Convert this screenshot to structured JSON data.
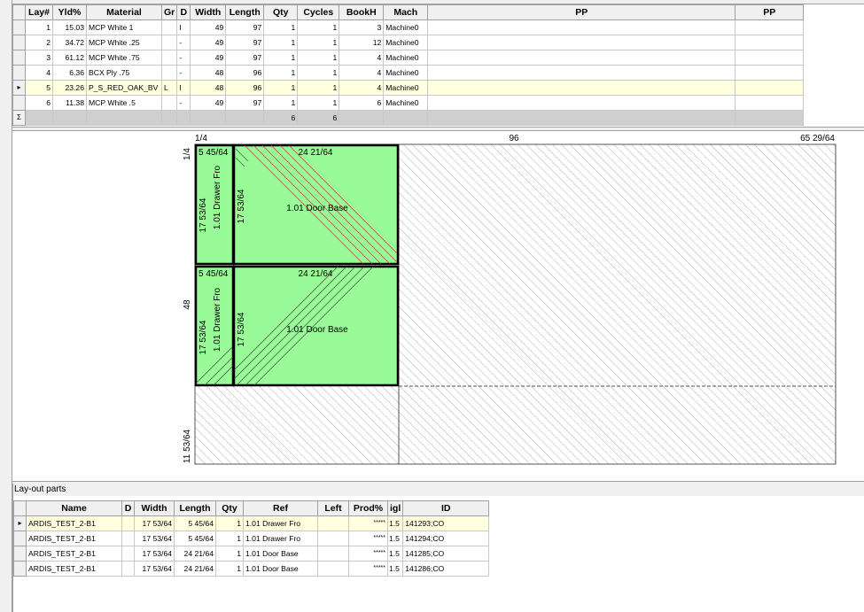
{
  "layouts": {
    "headers": [
      "Lay#",
      "Yld%",
      "Material",
      "Gr",
      "D",
      "Width",
      "Length",
      "Qty",
      "Cycles",
      "BookH",
      "Mach",
      "PP",
      "PP"
    ],
    "rows": [
      {
        "lay": "1",
        "yld": "15.03",
        "material": "MCP White 1",
        "gr": "",
        "d": "I",
        "width": "49",
        "length": "97",
        "qty": "1",
        "cycles": "1",
        "bookh": "3",
        "mach": "Machine0",
        "pp1": "",
        "pp2": ""
      },
      {
        "lay": "2",
        "yld": "34.72",
        "material": "MCP White .25",
        "gr": "",
        "d": "-",
        "width": "49",
        "length": "97",
        "qty": "1",
        "cycles": "1",
        "bookh": "12",
        "mach": "Machine0",
        "pp1": "",
        "pp2": ""
      },
      {
        "lay": "3",
        "yld": "61.12",
        "material": "MCP White .75",
        "gr": "",
        "d": "-",
        "width": "49",
        "length": "97",
        "qty": "1",
        "cycles": "1",
        "bookh": "4",
        "mach": "Machine0",
        "pp1": "",
        "pp2": ""
      },
      {
        "lay": "4",
        "yld": "6.36",
        "material": "BCX Ply .75",
        "gr": "",
        "d": "-",
        "width": "48",
        "length": "96",
        "qty": "1",
        "cycles": "1",
        "bookh": "4",
        "mach": "Machine0",
        "pp1": "",
        "pp2": ""
      },
      {
        "lay": "5",
        "yld": "23.26",
        "material": "P_S_RED_OAK_BV",
        "gr": "L",
        "d": "I",
        "width": "48",
        "length": "96",
        "qty": "1",
        "cycles": "1",
        "bookh": "4",
        "mach": "Machine0",
        "pp1": "",
        "pp2": ""
      },
      {
        "lay": "6",
        "yld": "11.38",
        "material": "MCP White .5",
        "gr": "",
        "d": "-",
        "width": "49",
        "length": "97",
        "qty": "1",
        "cycles": "1",
        "bookh": "6",
        "mach": "Machine0",
        "pp1": "",
        "pp2": ""
      }
    ],
    "selected_index": 4,
    "row_marker": "▸",
    "sum_marker": "Σ",
    "sum_qty": "6",
    "sum_cycles": "6"
  },
  "drawing": {
    "top_left_trim": "1/4",
    "top_mid_dim": "96",
    "top_right_dim": "65 29/64",
    "left_trim": "1/4",
    "left_mid_dim": "48",
    "left_bottom_dim": "11 53/64",
    "parts": [
      {
        "top_label": "5 45/64",
        "side_label": "17 53/64",
        "name": "1.01 Drawer Fro"
      },
      {
        "top_label": "24 21/64",
        "side_label": "17 53/64",
        "name": "1.01 Door Base"
      },
      {
        "top_label": "5 45/64",
        "side_label": "17 53/64",
        "name": "1.01 Drawer Fro"
      },
      {
        "top_label": "24 21/64",
        "side_label": "17 53/64",
        "name": "1.01 Door Base"
      }
    ],
    "part_fill": "#98fb98",
    "waste_hatch": "#a0a0a0"
  },
  "parts_panel": {
    "caption": "Lay-out parts",
    "headers": [
      "Name",
      "D",
      "Width",
      "Length",
      "Qty",
      "Ref",
      "Left",
      "Prod%",
      "igl",
      "ID"
    ],
    "rows": [
      {
        "name": "ARDIS_TEST_2-B1",
        "d": "",
        "width": "17 53/64",
        "length": "5 45/64",
        "qty": "1",
        "ref": "1.01 Drawer Fro",
        "left": "",
        "prod": "*****",
        "igl": "1.5",
        "id": "141293;CO"
      },
      {
        "name": "ARDIS_TEST_2-B1",
        "d": "",
        "width": "17 53/64",
        "length": "5 45/64",
        "qty": "1",
        "ref": "1.01 Drawer Fro",
        "left": "",
        "prod": "*****",
        "igl": "1.5",
        "id": "141294;CO"
      },
      {
        "name": "ARDIS_TEST_2-B1",
        "d": "",
        "width": "17 53/64",
        "length": "24 21/64",
        "qty": "1",
        "ref": "1.01 Door Base",
        "left": "",
        "prod": "*****",
        "igl": "1.5",
        "id": "141285;CO"
      },
      {
        "name": "ARDIS_TEST_2-B1",
        "d": "",
        "width": "17 53/64",
        "length": "24 21/64",
        "qty": "1",
        "ref": "1.01 Door Base",
        "left": "",
        "prod": "*****",
        "igl": "1.5",
        "id": "141286;CO"
      }
    ],
    "selected_index": 0,
    "row_marker": "▸"
  }
}
